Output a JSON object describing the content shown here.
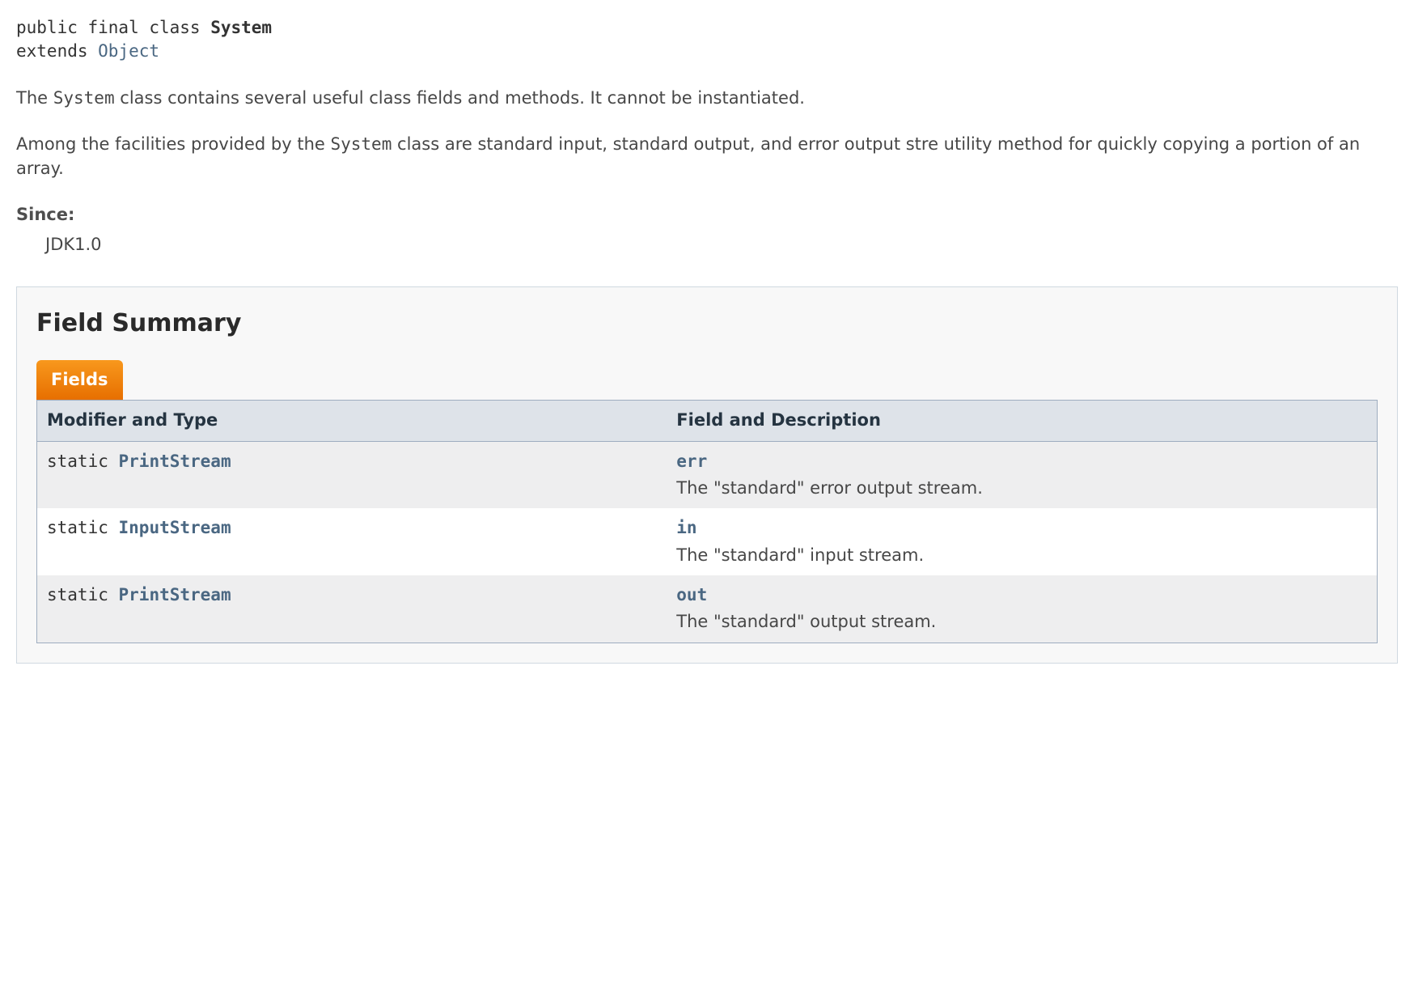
{
  "signature": {
    "prefix": "public final class ",
    "class_name": "System",
    "extends_prefix": "extends ",
    "extends_link": "Object"
  },
  "description": {
    "para1_pre": "The ",
    "para1_code": "System",
    "para1_post": " class contains several useful class fields and methods. It cannot be instantiated.",
    "para2_pre": "Among the facilities provided by the ",
    "para2_code": "System",
    "para2_post": " class are standard input, standard output, and error output stre utility method for quickly copying a portion of an array."
  },
  "since": {
    "label": "Since:",
    "value": "JDK1.0"
  },
  "summary": {
    "title": "Field Summary",
    "caption": "Fields",
    "headers": {
      "col1": "Modifier and Type",
      "col2": "Field and Description"
    },
    "rows": [
      {
        "modifier": "static ",
        "type": "PrintStream",
        "name": "err",
        "desc": "The \"standard\" error output stream."
      },
      {
        "modifier": "static ",
        "type": "InputStream",
        "name": "in",
        "desc": "The \"standard\" input stream."
      },
      {
        "modifier": "static ",
        "type": "PrintStream",
        "name": "out",
        "desc": "The \"standard\" output stream."
      }
    ]
  }
}
